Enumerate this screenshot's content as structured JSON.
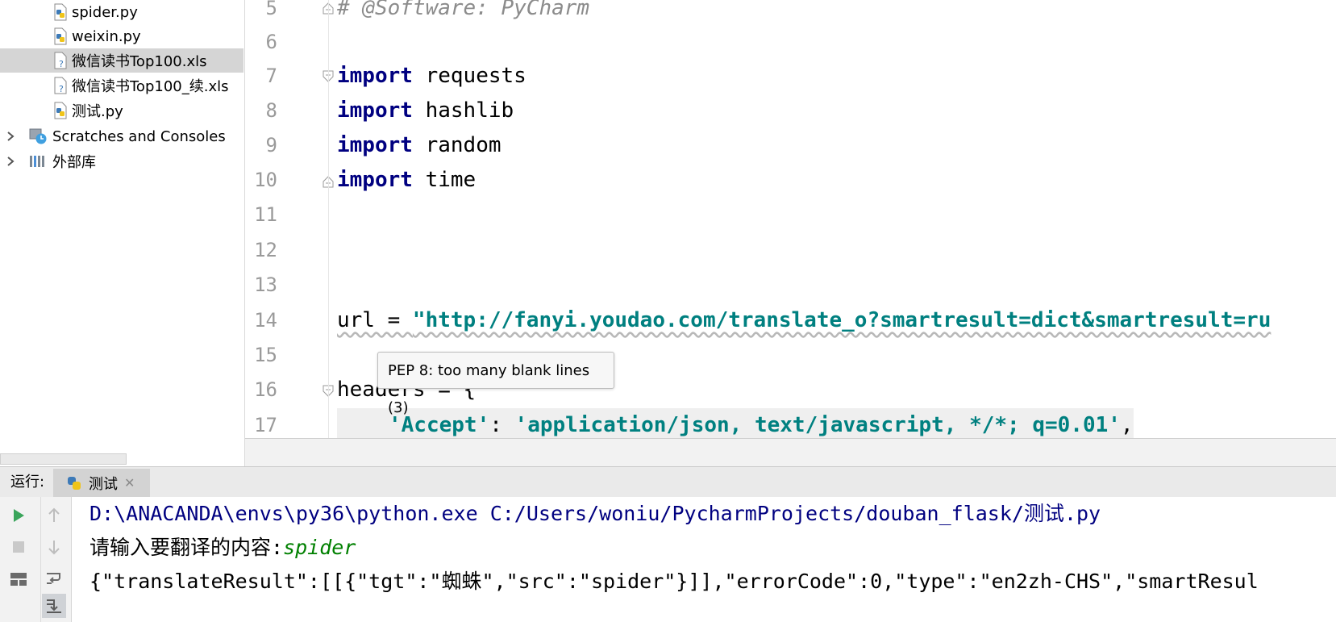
{
  "project_tree": {
    "items": [
      {
        "label": "spider.py",
        "icon": "python-file-icon"
      },
      {
        "label": "weixin.py",
        "icon": "python-file-icon"
      },
      {
        "label": "微信读书Top100.xls",
        "icon": "unknown-file-icon",
        "selected": true
      },
      {
        "label": "微信读书Top100_续.xls",
        "icon": "unknown-file-icon"
      },
      {
        "label": "测试.py",
        "icon": "python-file-icon"
      },
      {
        "label": "Scratches and Consoles",
        "icon": "scratches-icon",
        "expandable": true
      },
      {
        "label": "外部库",
        "icon": "library-icon",
        "expandable": true
      }
    ]
  },
  "editor": {
    "line_numbers": [
      "5",
      "6",
      "7",
      "8",
      "9",
      "10",
      "11",
      "12",
      "13",
      "14",
      "15",
      "16",
      "17"
    ],
    "lines": {
      "l5": "# @Software: PyCharm",
      "l7_kw": "import",
      "l7_mod": " requests",
      "l8_kw": "import",
      "l8_mod": " hashlib",
      "l9_kw": "import",
      "l9_mod": " random",
      "l10_kw": "import",
      "l10_mod": " time",
      "l14_pre": "url = ",
      "l14_str": "\"http://fanyi.youdao.com/translate_o?smartresult=dict&smartresult=ru",
      "l16": "headers = {",
      "l17_key": "'Accept'",
      "l17_sep": ": ",
      "l17_val": "'application/json, text/javascript, */*; q=0.01'",
      "l17_end": ","
    },
    "tooltip": "PEP 8: too many blank lines (3)"
  },
  "run_panel": {
    "label": "运行:",
    "tab_label": "测试",
    "console": {
      "path_line": "D:\\ANACANDA\\envs\\py36\\python.exe C:/Users/woniu/PycharmProjects/douban_flask/测试.py",
      "prompt": "请输入要翻译的内容:",
      "input": "spider",
      "output": "{\"translateResult\":[[{\"tgt\":\"蜘蛛\",\"src\":\"spider\"}]],\"errorCode\":0,\"type\":\"en2zh-CHS\",\"smartResul"
    }
  },
  "colors": {
    "keyword": "#000080",
    "string": "#008080",
    "comment": "#8c8c8c",
    "console_input": "#008000",
    "selection": "#d5d5d5"
  }
}
